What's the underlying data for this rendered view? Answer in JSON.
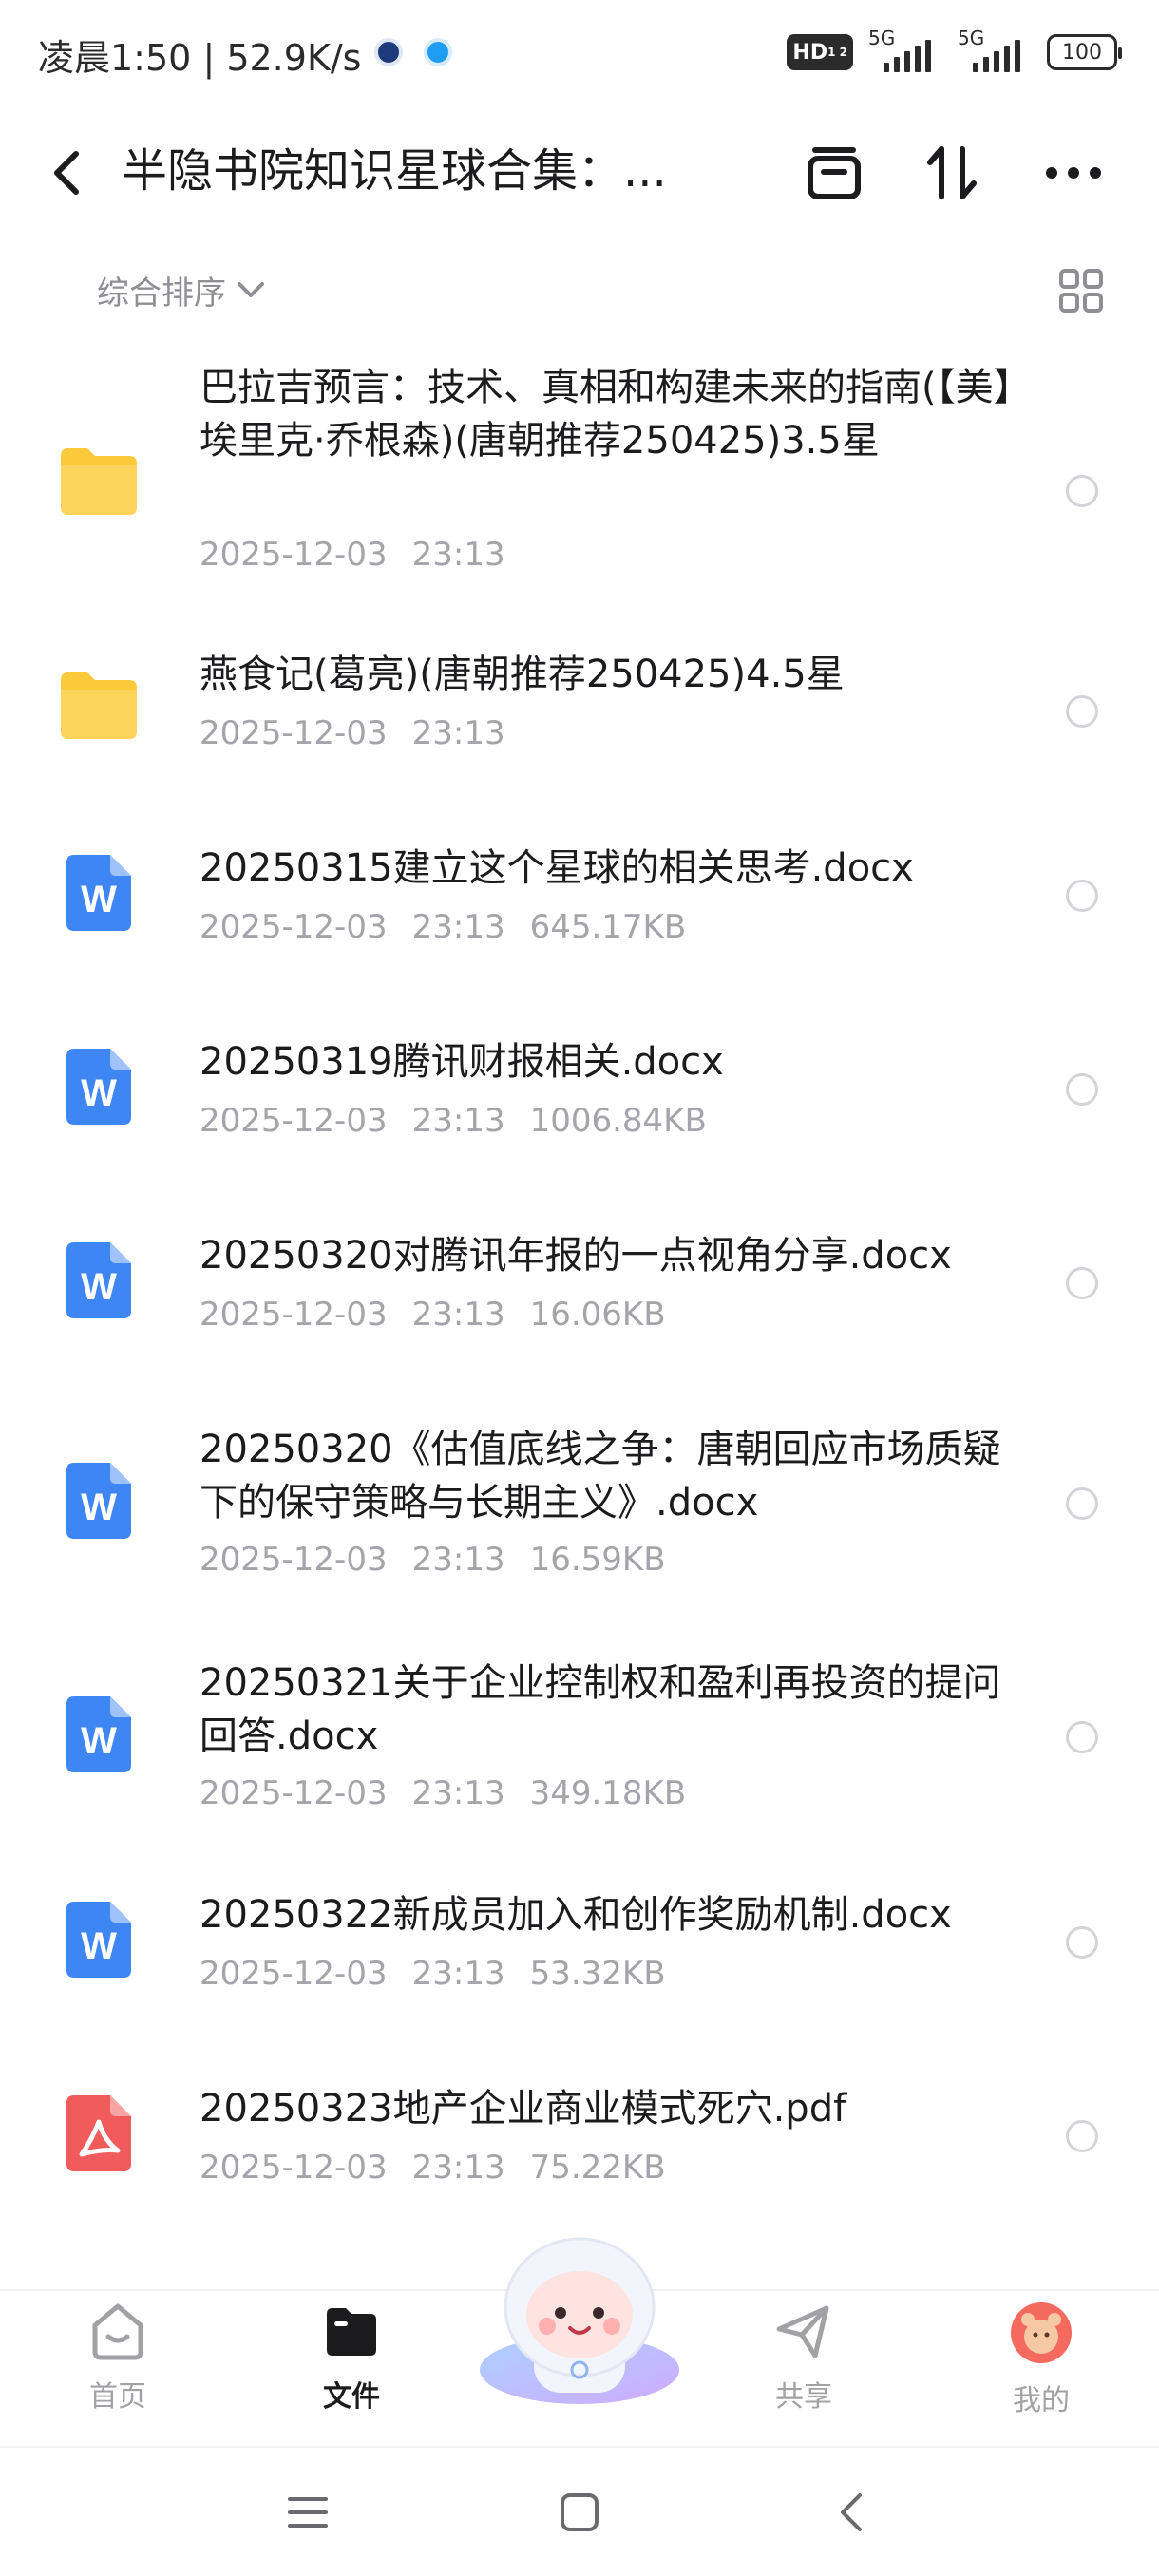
{
  "status_bar": {
    "time": "凌晨1:50",
    "net_speed": "52.9K/s",
    "hd_label": "HD",
    "network1": "5G",
    "network2": "5G",
    "battery": "100"
  },
  "header": {
    "title": "半隐书院知识星球合集：..."
  },
  "toolbar": {
    "sort_label": "综合排序"
  },
  "files": [
    {
      "type": "folder",
      "name": "巴拉吉预言：技术、真相和构建未来的指南(【美】埃里克·乔根森)(唐朝推荐250425)3.5星",
      "date": "2025-12-03",
      "time": "23:13",
      "size": ""
    },
    {
      "type": "folder",
      "name": "燕食记(葛亮)(唐朝推荐250425)4.5星",
      "date": "2025-12-03",
      "time": "23:13",
      "size": ""
    },
    {
      "type": "docx",
      "name": "20250315建立这个星球的相关思考.docx",
      "date": "2025-12-03",
      "time": "23:13",
      "size": "645.17KB"
    },
    {
      "type": "docx",
      "name": "20250319腾讯财报相关.docx",
      "date": "2025-12-03",
      "time": "23:13",
      "size": "1006.84KB"
    },
    {
      "type": "docx",
      "name": "20250320对腾讯年报的一点视角分享.docx",
      "date": "2025-12-03",
      "time": "23:13",
      "size": "16.06KB"
    },
    {
      "type": "docx",
      "name": "20250320《估值底线之争：唐朝回应市场质疑下的保守策略与长期主义》.docx",
      "date": "2025-12-03",
      "time": "23:13",
      "size": "16.59KB"
    },
    {
      "type": "docx",
      "name": "20250321关于企业控制权和盈利再投资的提问回答.docx",
      "date": "2025-12-03",
      "time": "23:13",
      "size": "349.18KB"
    },
    {
      "type": "docx",
      "name": "20250322新成员加入和创作奖励机制.docx",
      "date": "2025-12-03",
      "time": "23:13",
      "size": "53.32KB"
    },
    {
      "type": "pdf",
      "name": "20250323地产企业商业模式死穴.pdf",
      "date": "2025-12-03",
      "time": "23:13",
      "size": "75.22KB"
    }
  ],
  "tabs": {
    "home": "首页",
    "files": "文件",
    "share": "共享",
    "mine": "我的"
  },
  "colors": {
    "folder": "#fcc93a",
    "word": "#3f86f5",
    "pdf": "#f25b5b",
    "meta_gray": "#a4a4aa"
  }
}
